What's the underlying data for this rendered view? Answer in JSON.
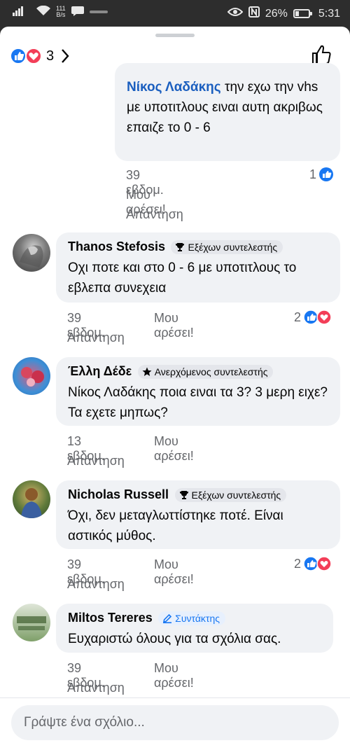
{
  "status_bar": {
    "net_speed_value": "111",
    "net_speed_unit": "B/s",
    "battery_percent": "26%",
    "time": "5:31"
  },
  "header": {
    "reaction_count": "3"
  },
  "comments": [
    {
      "mention": "Νίκος Λαδάκης",
      "text": " την εχω την vhs με υποτιτλους ειναι αυτη ακριβως επαιζε το 0 - 6",
      "time": "39 εβδομ.",
      "like_label": "Μου αρέσει!",
      "reply_label": "Απάντηση",
      "reaction_count": "1"
    },
    {
      "name": "Thanos Stefosis",
      "badge": "Εξέχων συντελεστής",
      "text": "Οχι ποτε και στο 0 - 6 με υποτιτλους το εβλεπα συνεχεια",
      "time": "39 εβδομ.",
      "like_label": "Μου αρέσει!",
      "reply_label": "Απάντηση",
      "reaction_count": "2"
    },
    {
      "name": "Έλλη Δέδε",
      "badge": "Ανερχόμενος συντελεστής",
      "text": "Νίκος Λαδάκης ποια ειναι τα 3? 3 μερη ειχε? Τα εχετε μηπως?",
      "time": "13 εβδομ.",
      "like_label": "Μου αρέσει!",
      "reply_label": "Απάντηση"
    },
    {
      "name": "Nicholas Russell",
      "badge": "Εξέχων συντελεστής",
      "text": "Όχι, δεν μεταγλωττίστηκε ποτέ. Είναι αστικός μύθος.",
      "time": "39 εβδομ.",
      "like_label": "Μου αρέσει!",
      "reply_label": "Απάντηση",
      "reaction_count": "2"
    },
    {
      "name": "Miltos Tereres",
      "badge": "Συντάκτης",
      "text": "Ευχαριστώ όλους για τα σχόλια σας.",
      "time": "39 εβδομ.",
      "like_label": "Μου αρέσει!",
      "reply_label": "Απάντηση"
    }
  ],
  "composer": {
    "placeholder": "Γράψτε ένα σχόλιο..."
  },
  "colors": {
    "like_blue": "#1877f2",
    "love_red": "#f33e58",
    "bubble_bg": "#f0f2f5",
    "mention_blue": "#1b5fbf"
  }
}
